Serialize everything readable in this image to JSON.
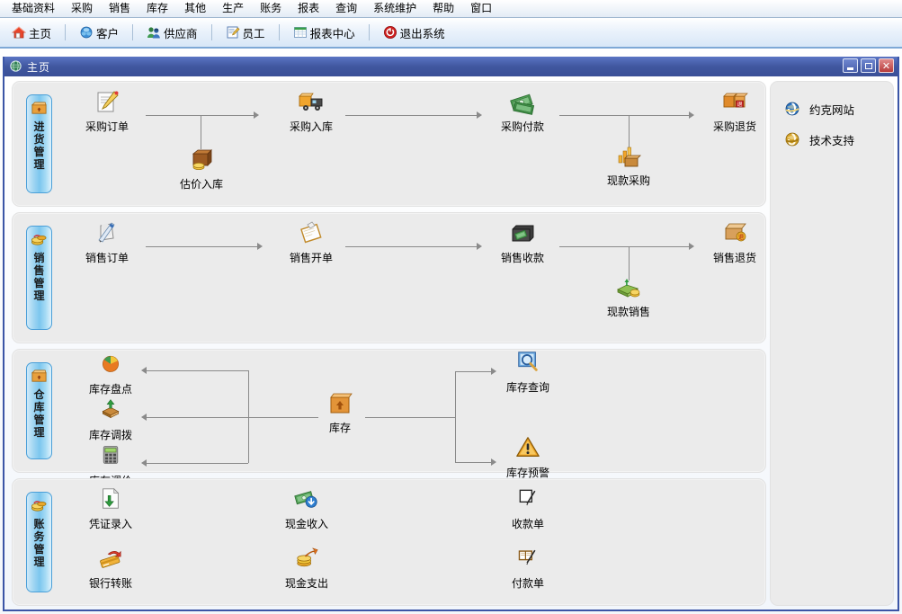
{
  "menubar": {
    "items": [
      {
        "label": "基础资料",
        "name": "menu-basic-data"
      },
      {
        "label": "采购",
        "name": "menu-purchase"
      },
      {
        "label": "销售",
        "name": "menu-sales"
      },
      {
        "label": "库存",
        "name": "menu-inventory"
      },
      {
        "label": "其他",
        "name": "menu-other"
      },
      {
        "label": "生产",
        "name": "menu-production"
      },
      {
        "label": "账务",
        "name": "menu-accounting"
      },
      {
        "label": "报表",
        "name": "menu-reports"
      },
      {
        "label": "查询",
        "name": "menu-query"
      },
      {
        "label": "系统维护",
        "name": "menu-system-maintenance"
      },
      {
        "label": "帮助",
        "name": "menu-help"
      },
      {
        "label": "窗口",
        "name": "menu-window"
      }
    ]
  },
  "toolbar": {
    "buttons": [
      {
        "label": "主页",
        "icon": "home-icon",
        "name": "toolbar-home"
      },
      {
        "label": "客户",
        "icon": "customer-icon",
        "name": "toolbar-customer"
      },
      {
        "label": "供应商",
        "icon": "supplier-icon",
        "name": "toolbar-supplier"
      },
      {
        "label": "员工",
        "icon": "employee-icon",
        "name": "toolbar-employee"
      },
      {
        "label": "报表中心",
        "icon": "report-center-icon",
        "name": "toolbar-report-center"
      },
      {
        "label": "退出系统",
        "icon": "power-icon",
        "name": "toolbar-exit"
      }
    ]
  },
  "window": {
    "title": "主页",
    "icon": "globe-icon",
    "minimize_label": "最小化",
    "maximize_label": "最大化",
    "close_label": "关闭"
  },
  "sections": [
    {
      "tab_label": "进货管理",
      "tab_icon": "box-orange-icon",
      "name": "section-purchase-management",
      "nodes": [
        {
          "label": "采购订单",
          "icon": "order-pencil-icon",
          "name": "node-purchase-order"
        },
        {
          "label": "估价入库",
          "icon": "box-coins-icon",
          "name": "node-estimated-receipt"
        },
        {
          "label": "采购入库",
          "icon": "truck-box-icon",
          "name": "node-purchase-receipt"
        },
        {
          "label": "采购付款",
          "icon": "money-green-icon",
          "name": "node-purchase-payment"
        },
        {
          "label": "现款采购",
          "icon": "chart-box-icon",
          "name": "node-cash-purchase"
        },
        {
          "label": "采购退货",
          "icon": "box-return-icon",
          "name": "node-purchase-return"
        }
      ]
    },
    {
      "tab_label": "销售管理",
      "tab_icon": "coins-icon",
      "name": "section-sales-management",
      "nodes": [
        {
          "label": "销售订单",
          "icon": "book-pen-icon",
          "name": "node-sales-order"
        },
        {
          "label": "销售开单",
          "icon": "invoice-icon",
          "name": "node-sales-invoice"
        },
        {
          "label": "销售收款",
          "icon": "safe-money-icon",
          "name": "node-sales-receipt"
        },
        {
          "label": "现款销售",
          "icon": "cash-sale-icon",
          "name": "node-cash-sale"
        },
        {
          "label": "销售退货",
          "icon": "box-return-icon",
          "name": "node-sales-return"
        }
      ]
    },
    {
      "tab_label": "仓库管理",
      "tab_icon": "box-orange-icon",
      "name": "section-warehouse-management",
      "nodes": [
        {
          "label": "库存盘点",
          "icon": "pie-chart-icon",
          "name": "node-stocktaking"
        },
        {
          "label": "库存调拨",
          "icon": "box-arrow-up-icon",
          "name": "node-stock-transfer"
        },
        {
          "label": "库存调价",
          "icon": "calculator-icon",
          "name": "node-price-adjust"
        },
        {
          "label": "库存",
          "icon": "box-big-icon",
          "name": "node-inventory"
        },
        {
          "label": "库存查询",
          "icon": "search-blue-icon",
          "name": "node-stock-query"
        },
        {
          "label": "库存预警",
          "icon": "warning-triangle-icon",
          "name": "node-stock-warning"
        }
      ]
    },
    {
      "tab_label": "账务管理",
      "tab_icon": "coins-icon",
      "name": "section-accounting-management",
      "nodes": [
        {
          "label": "凭证录入",
          "icon": "document-down-icon",
          "name": "node-voucher-entry"
        },
        {
          "label": "银行转账",
          "icon": "card-transfer-icon",
          "name": "node-bank-transfer"
        },
        {
          "label": "现金收入",
          "icon": "money-in-icon",
          "name": "node-cash-income"
        },
        {
          "label": "现金支出",
          "icon": "money-out-icon",
          "name": "node-cash-expense"
        },
        {
          "label": "收款单",
          "icon": "receipt-pen-icon",
          "name": "node-receipt-voucher"
        },
        {
          "label": "付款单",
          "icon": "payment-pen-icon",
          "name": "node-payment-voucher"
        }
      ]
    }
  ],
  "right_panel": {
    "links": [
      {
        "label": "约克网站",
        "icon": "ie-blue-icon",
        "name": "link-york-website"
      },
      {
        "label": "技术支持",
        "icon": "ie-gold-icon",
        "name": "link-tech-support"
      }
    ]
  },
  "colors": {
    "titlebar": "#40579f",
    "window_border": "#3b55a6",
    "section_bg": "#ebebeb",
    "tab_blue": "#7cc6ee",
    "connector": "#8a8a8a"
  }
}
